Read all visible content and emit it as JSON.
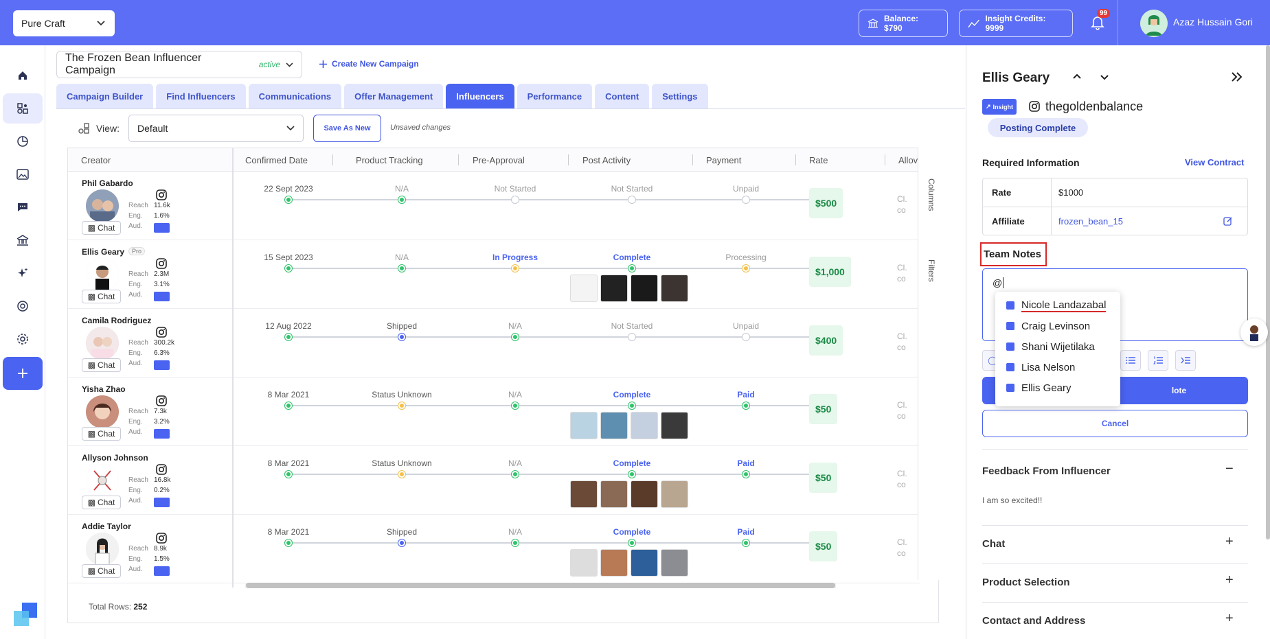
{
  "topbar": {
    "workspace": "Pure Craft",
    "balance": "Balance: $790",
    "credits": "Insight Credits: 9999",
    "notifications": "99",
    "user": "Azaz Hussain Gori"
  },
  "campaign": {
    "name": "The Frozen Bean Influencer Campaign",
    "status": "active",
    "create_label": "Create New Campaign"
  },
  "tabs": [
    "Campaign Builder",
    "Find Influencers",
    "Communications",
    "Offer Management",
    "Influencers",
    "Performance",
    "Content",
    "Settings"
  ],
  "active_tab": "Influencers",
  "view": {
    "label": "View:",
    "selected": "Default",
    "save_label": "Save As New",
    "unsaved": "Unsaved changes"
  },
  "columns": [
    "Creator",
    "Confirmed Date",
    "Product Tracking",
    "Pre-Approval",
    "Post Activity",
    "Payment",
    "Rate",
    "Allov"
  ],
  "stat_labels": [
    "Reach",
    "Eng.",
    "Aud."
  ],
  "chat_label": "Chat",
  "pro_label": "Pro",
  "side_tools": [
    "Columns",
    "Filters"
  ],
  "rows": [
    {
      "name": "Phil Gabardo",
      "reach": "11.6k",
      "eng": "1.6%",
      "date": "22 Sept 2023",
      "tracking": "N/A",
      "preapproval": "Not Started",
      "post": "Not Started",
      "payment": "Unpaid",
      "rate": "$500",
      "cl": "Cl.",
      "co": "co"
    },
    {
      "name": "Ellis Geary",
      "reach": "2.3M",
      "eng": "3.1%",
      "date": "15 Sept 2023",
      "tracking": "N/A",
      "preapproval": "In Progress",
      "post": "Complete",
      "payment": "Processing",
      "rate": "$1,000",
      "cl": "Cl.",
      "co": "co"
    },
    {
      "name": "Camila Rodriguez",
      "reach": "300.2k",
      "eng": "6.3%",
      "date": "12 Aug 2022",
      "tracking": "Shipped",
      "preapproval": "N/A",
      "post": "Not Started",
      "payment": "Unpaid",
      "rate": "$400",
      "cl": "Cl.",
      "co": "co"
    },
    {
      "name": "Yisha Zhao",
      "reach": "7.3k",
      "eng": "3.2%",
      "date": "8 Mar 2021",
      "tracking": "Status Unknown",
      "preapproval": "N/A",
      "post": "Complete",
      "payment": "Paid",
      "rate": "$50",
      "cl": "Cl.",
      "co": "co"
    },
    {
      "name": "Allyson Johnson",
      "reach": "16.8k",
      "eng": "0.2%",
      "date": "8 Mar 2021",
      "tracking": "Status Unknown",
      "preapproval": "N/A",
      "post": "Complete",
      "payment": "Paid",
      "rate": "$50",
      "cl": "Cl.",
      "co": "co"
    },
    {
      "name": "Addie Taylor",
      "reach": "8.9k",
      "eng": "1.5%",
      "date": "8 Mar 2021",
      "tracking": "Shipped",
      "preapproval": "N/A",
      "post": "Complete",
      "payment": "Paid",
      "rate": "$50",
      "cl": "Cl.",
      "co": "co"
    }
  ],
  "total_rows_label": "Total Rows:",
  "total_rows": "252",
  "panel": {
    "name": "Ellis Geary",
    "insight": "Insight",
    "handle": "thegoldenbalance",
    "posting": "Posting Complete",
    "required": "Required Information",
    "view_contract": "View Contract",
    "rate_label": "Rate",
    "rate_value": "$1000",
    "affiliate_label": "Affiliate",
    "affiliate_value": "frozen_bean_15",
    "team_notes": "Team Notes",
    "note_text": "@",
    "add_note_suffix": "lote",
    "cancel": "Cancel",
    "mentions": [
      "Nicole Landazabal",
      "Craig Levinson",
      "Shani Wijetilaka",
      "Lisa Nelson",
      "Ellis Geary"
    ],
    "feedback_title": "Feedback From Influencer",
    "feedback_text": "I am so excited!!",
    "sections": [
      "Chat",
      "Product Selection",
      "Contact and Address"
    ]
  },
  "colors": {
    "accent": "#4a63f0",
    "topbar": "#5b6ef5",
    "complete": "#2fc36a",
    "pending": "#f5c04a"
  }
}
